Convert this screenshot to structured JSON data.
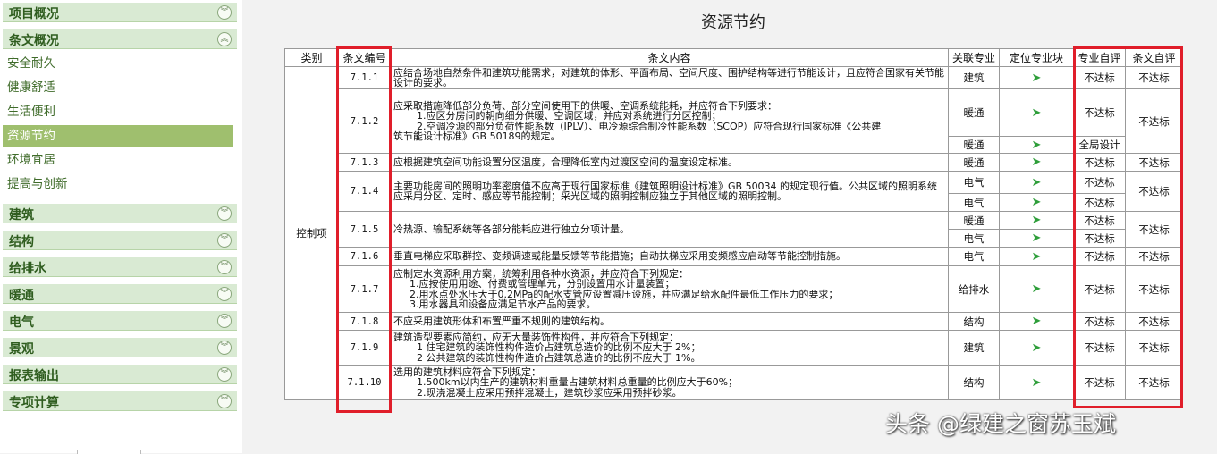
{
  "sidebar": {
    "sections": [
      {
        "label": "项目概况",
        "expanded": false
      },
      {
        "label": "条文概况",
        "expanded": true
      },
      {
        "label": "建筑",
        "expanded": false
      },
      {
        "label": "结构",
        "expanded": false
      },
      {
        "label": "给排水",
        "expanded": false
      },
      {
        "label": "暖通",
        "expanded": false
      },
      {
        "label": "电气",
        "expanded": false
      },
      {
        "label": "景观",
        "expanded": false
      },
      {
        "label": "报表输出",
        "expanded": false
      },
      {
        "label": "专项计算",
        "expanded": false
      }
    ],
    "subitems": [
      "安全耐久",
      "健康舒适",
      "生活便利",
      "资源节约",
      "环境宜居",
      "提高与创新"
    ],
    "active_subitem": "资源节约",
    "active_color": "#9fbf6e"
  },
  "page": {
    "title": "资源节约"
  },
  "table": {
    "headers": [
      "类别",
      "条文编号",
      "条文内容",
      "关联专业",
      "定位专业块",
      "专业自评",
      "条文自评"
    ],
    "category": "控制项",
    "rows": [
      {
        "code": "7.1.1",
        "content": [
          "应结合场地自然条件和建筑功能需求，对建筑的体形、平面布局、空间尺度、围护结构等进行节能设计，且应符合国家有关节能设计的要求。"
        ],
        "disciplines": [
          "建筑"
        ],
        "pro_eval": [
          "不达标"
        ],
        "clause_eval": "不达标"
      },
      {
        "code": "7.1.2",
        "content": [
          "应采取措施降低部分负荷、部分空间使用下的供暖、空调系统能耗，并应符合下列要求：",
          "1.应区分房间的朝向细分供暖、空调区域，并应对系统进行分区控制；",
          "2.空调冷源的部分负荷性能系数（IPLV）、电冷源综合制冷性能系数（SCOP）应符合现行国家标准《公共建",
          "筑节能设计标准》GB 50189的规定。"
        ],
        "disciplines": [
          "暖通",
          "暖通"
        ],
        "pro_eval": [
          "不达标",
          "全局设计"
        ],
        "clause_eval": "不达标"
      },
      {
        "code": "7.1.3",
        "content": [
          "应根据建筑空间功能设置分区温度，合理降低室内过渡区空间的温度设定标准。"
        ],
        "disciplines": [
          "暖通"
        ],
        "pro_eval": [
          "不达标"
        ],
        "clause_eval": "不达标"
      },
      {
        "code": "7.1.4",
        "content": [
          "主要功能房间的照明功率密度值不应高于现行国家标准《建筑照明设计标准》GB 50034 的规定现行值。公共区域的照明系统应采用分区、定时、感应等节能控制；采光区域的照明控制应独立于其他区域的照明控制。"
        ],
        "disciplines": [
          "电气",
          "电气"
        ],
        "pro_eval": [
          "不达标",
          "不达标"
        ],
        "clause_eval": "不达标"
      },
      {
        "code": "7.1.5",
        "content": [
          "冷热源、输配系统等各部分能耗应进行独立分项计量。"
        ],
        "disciplines": [
          "暖通",
          "电气"
        ],
        "pro_eval": [
          "不达标",
          "不达标"
        ],
        "clause_eval": "不达标"
      },
      {
        "code": "7.1.6",
        "content": [
          "垂直电梯应采取群控、变频调速或能量反馈等节能措施；自动扶梯应采用变频感应启动等节能控制措施。"
        ],
        "disciplines": [
          "电气"
        ],
        "pro_eval": [
          "不达标"
        ],
        "clause_eval": "不达标"
      },
      {
        "code": "7.1.7",
        "content": [
          "应制定水资源利用方案，统筹利用各种水资源，并应符合下列规定：",
          "1.应按使用用途、付费或管理单元，分别设置用水计量装置；",
          "2.用水点处水压大于0.2MPa的配水支管应设置减压设施，并应满足给水配件最低工作压力的要求；",
          "3.用水器具和设备应满足节水产品的要求。"
        ],
        "disciplines": [
          "给排水"
        ],
        "pro_eval": [
          "不达标"
        ],
        "clause_eval": "不达标"
      },
      {
        "code": "7.1.8",
        "content": [
          "不应采用建筑形体和布置严重不规则的建筑结构。"
        ],
        "disciplines": [
          "结构"
        ],
        "pro_eval": [
          "不达标"
        ],
        "clause_eval": "不达标"
      },
      {
        "code": "7.1.9",
        "content": [
          "建筑造型要素应简约，应无大量装饰性构件，并应符合下列规定：",
          "1 住宅建筑的装饰性构件造价占建筑总造价的比例不应大于 2%；",
          "2 公共建筑的装饰性构件造价占建筑总造价的比例不应大于 1%。"
        ],
        "disciplines": [
          "建筑"
        ],
        "pro_eval": [
          "不达标"
        ],
        "clause_eval": "不达标"
      },
      {
        "code": "7.1.10",
        "content": [
          "选用的建筑材料应符合下列规定：",
          "1.500km以内生产的建筑材料重量占建筑材料总重量的比例应大于60%；",
          "2.现浇混凝土应采用预拌混凝土，建筑砂浆应采用预拌砂浆。"
        ],
        "disciplines": [
          "结构"
        ],
        "pro_eval": [
          "不达标"
        ],
        "clause_eval": "不达标"
      }
    ]
  },
  "highlight_color": "#e01e2a",
  "locate_icon": "send-arrow-icon",
  "watermark": "头条 @绿建之窗苏玉斌"
}
